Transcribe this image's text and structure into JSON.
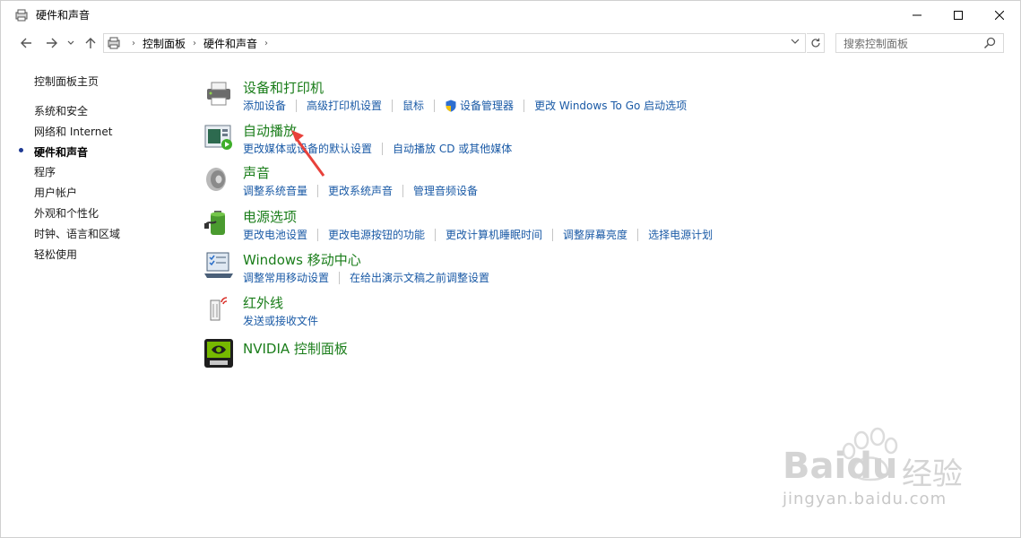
{
  "window": {
    "title": "硬件和声音"
  },
  "address": {
    "crumbs": [
      "控制面板",
      "硬件和声音"
    ],
    "search_placeholder": "搜索控制面板"
  },
  "sidebar": {
    "items": [
      {
        "label": "控制面板主页"
      },
      {
        "label": "系统和安全"
      },
      {
        "label": "网络和 Internet"
      },
      {
        "label": "硬件和声音",
        "current": true
      },
      {
        "label": "程序"
      },
      {
        "label": "用户帐户"
      },
      {
        "label": "外观和个性化"
      },
      {
        "label": "时钟、语言和区域"
      },
      {
        "label": "轻松使用"
      }
    ]
  },
  "categories": [
    {
      "title": "设备和打印机",
      "icon": "printer-icon",
      "links": [
        "添加设备",
        "高级打印机设置",
        "鼠标",
        "设备管理器",
        "更改 Windows To Go 启动选项"
      ]
    },
    {
      "title": "自动播放",
      "icon": "autoplay-icon",
      "links": [
        "更改媒体或设备的默认设置",
        "自动播放 CD 或其他媒体"
      ]
    },
    {
      "title": "声音",
      "icon": "speaker-icon",
      "links": [
        "调整系统音量",
        "更改系统声音",
        "管理音频设备"
      ]
    },
    {
      "title": "电源选项",
      "icon": "battery-icon",
      "links": [
        "更改电池设置",
        "更改电源按钮的功能",
        "更改计算机睡眠时间",
        "调整屏幕亮度",
        "选择电源计划"
      ]
    },
    {
      "title": "Windows 移动中心",
      "icon": "mobility-center-icon",
      "links": [
        "调整常用移动设置",
        "在给出演示文稿之前调整设置"
      ]
    },
    {
      "title": "红外线",
      "icon": "infrared-icon",
      "links": [
        "发送或接收文件"
      ]
    },
    {
      "title": "NVIDIA 控制面板",
      "icon": "nvidia-icon",
      "links": []
    }
  ],
  "watermark": {
    "brand": "Baidu",
    "brand_cn": "经验",
    "url": "jingyan.baidu.com"
  },
  "colors": {
    "category_title": "#1a7d1a",
    "link": "#1a5aa6",
    "annotation_arrow": "#e8413b"
  }
}
